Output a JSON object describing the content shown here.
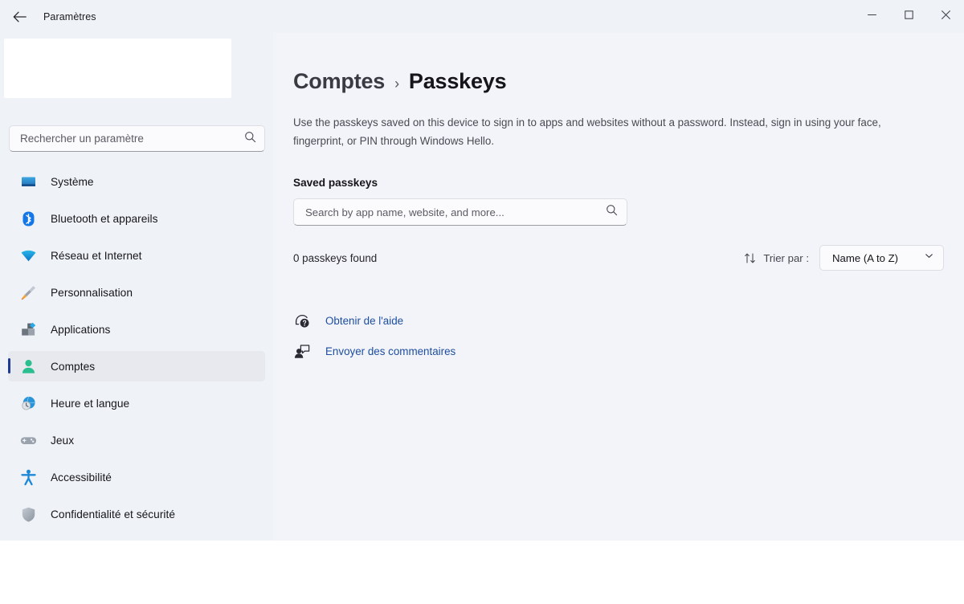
{
  "window": {
    "title": "Paramètres",
    "back_icon": "back-arrow-icon",
    "caption": {
      "minimize": "minimize-icon",
      "maximize": "maximize-icon",
      "close": "close-icon"
    }
  },
  "sidebar": {
    "search": {
      "placeholder": "Rechercher un paramètre",
      "icon": "search-icon"
    },
    "items": [
      {
        "label": "Système",
        "icon": "monitor-icon",
        "selected": false
      },
      {
        "label": "Bluetooth et appareils",
        "icon": "bluetooth-icon",
        "selected": false
      },
      {
        "label": "Réseau et Internet",
        "icon": "wifi-icon",
        "selected": false
      },
      {
        "label": "Personnalisation",
        "icon": "paintbrush-icon",
        "selected": false
      },
      {
        "label": "Applications",
        "icon": "apps-icon",
        "selected": false
      },
      {
        "label": "Comptes",
        "icon": "person-icon",
        "selected": true
      },
      {
        "label": "Heure et langue",
        "icon": "clock-globe-icon",
        "selected": false
      },
      {
        "label": "Jeux",
        "icon": "gamepad-icon",
        "selected": false
      },
      {
        "label": "Accessibilité",
        "icon": "accessibility-icon",
        "selected": false
      },
      {
        "label": "Confidentialité et sécurité",
        "icon": "shield-icon",
        "selected": false
      }
    ]
  },
  "content": {
    "breadcrumb": {
      "parent": "Comptes",
      "separator": "›",
      "current": "Passkeys"
    },
    "description": "Use the passkeys saved on this device to sign in to apps and websites without a password. Instead, sign in using your face, fingerprint, or PIN through Windows Hello.",
    "section_title": "Saved passkeys",
    "search": {
      "placeholder": "Search by app name, website, and more...",
      "icon": "search-icon"
    },
    "results_count": "0 passkeys found",
    "sort": {
      "icon": "sort-arrows-icon",
      "label": "Trier par :",
      "value": "Name (A to Z)",
      "chevron": "chevron-down-icon"
    },
    "help_links": [
      {
        "label": "Obtenir de l'aide",
        "icon": "help-question-icon"
      },
      {
        "label": "Envoyer des commentaires",
        "icon": "feedback-person-icon"
      }
    ]
  },
  "colors": {
    "accent_bar": "#1f3a93",
    "link": "#1d4ea0",
    "window_bg": "#f3f4f9",
    "sidebar_bg": "#eff2f7",
    "selected_bg": "#e7e9ee"
  }
}
